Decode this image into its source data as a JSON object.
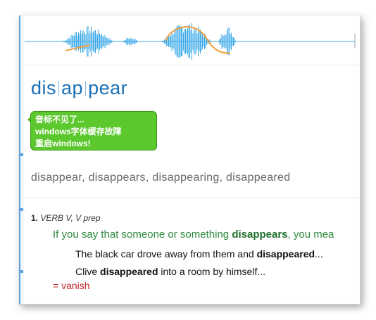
{
  "headword": {
    "syllables": [
      "dis",
      "ap",
      "pear"
    ]
  },
  "tooltip": {
    "lines": [
      "音标不见了...",
      "windows字体缓存故障",
      "重启windows!"
    ]
  },
  "inflections": "disappear, disappears, disappearing, disappeared",
  "sense": {
    "number": "1.",
    "grammar": "VERB V, V prep",
    "definition_prefix": "If you say that someone or something ",
    "definition_keyword": "disappears",
    "definition_suffix": ", you mea",
    "examples": [
      {
        "before": "The black car drove away from them and ",
        "keyword": "disappeared",
        "after": "..."
      },
      {
        "before": "Clive ",
        "keyword": "disappeared",
        "after": " into a room by himself..."
      }
    ],
    "synonym": "= vanish"
  },
  "colors": {
    "waveform": "#3aa8e8",
    "pitch_curve": "#f0a040",
    "headword": "#1a6fb4",
    "tooltip_bg": "#5bc82d",
    "definition": "#2e8b3e",
    "synonym": "#c0262d"
  }
}
